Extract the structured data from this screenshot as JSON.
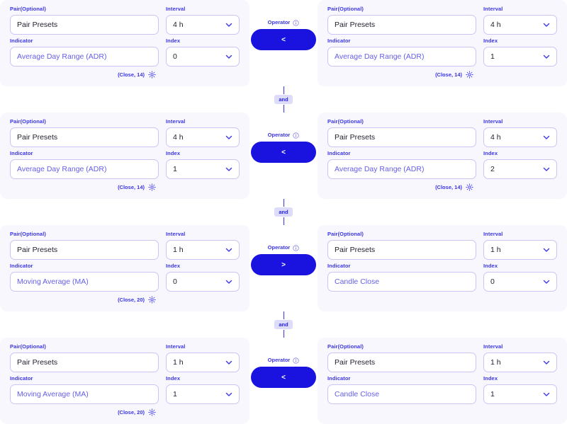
{
  "labels": {
    "pair": "Pair(Optional)",
    "interval": "Interval",
    "indicator": "Indicator",
    "index": "Index",
    "operator": "Operator"
  },
  "icons": {
    "chevron": "chevron-down-icon",
    "gear": "gear-icon",
    "info": "info-icon"
  },
  "colors": {
    "accent": "#1a13e0",
    "label": "#3b35e8",
    "panel_bg": "#f7f7fd",
    "border": "#c9c6f5",
    "badge_bg": "#dedcfb",
    "placeholder": "#6560e8"
  },
  "connector": {
    "label": "and"
  },
  "rows": [
    {
      "left": {
        "pair": "Pair Presets",
        "interval": "4 h",
        "indicator": "Average Day Range (ADR)",
        "index": "0",
        "params": "(Close, 14)"
      },
      "operator": "<",
      "right": {
        "pair": "Pair Presets",
        "interval": "4 h",
        "indicator": "Average Day Range (ADR)",
        "index": "1",
        "params": "(Close, 14)"
      }
    },
    {
      "left": {
        "pair": "Pair Presets",
        "interval": "4 h",
        "indicator": "Average Day Range (ADR)",
        "index": "1",
        "params": "(Close, 14)"
      },
      "operator": "<",
      "right": {
        "pair": "Pair Presets",
        "interval": "4 h",
        "indicator": "Average Day Range (ADR)",
        "index": "2",
        "params": "(Close, 14)"
      }
    },
    {
      "left": {
        "pair": "Pair Presets",
        "interval": "1 h",
        "indicator": "Moving Average (MA)",
        "index": "0",
        "params": "(Close, 20)"
      },
      "operator": ">",
      "right": {
        "pair": "Pair Presets",
        "interval": "1 h",
        "indicator": "Candle Close",
        "index": "0",
        "params": ""
      }
    },
    {
      "left": {
        "pair": "Pair Presets",
        "interval": "1 h",
        "indicator": "Moving Average (MA)",
        "index": "1",
        "params": "(Close, 20)"
      },
      "operator": "<",
      "right": {
        "pair": "Pair Presets",
        "interval": "1 h",
        "indicator": "Candle Close",
        "index": "1",
        "params": ""
      }
    }
  ]
}
